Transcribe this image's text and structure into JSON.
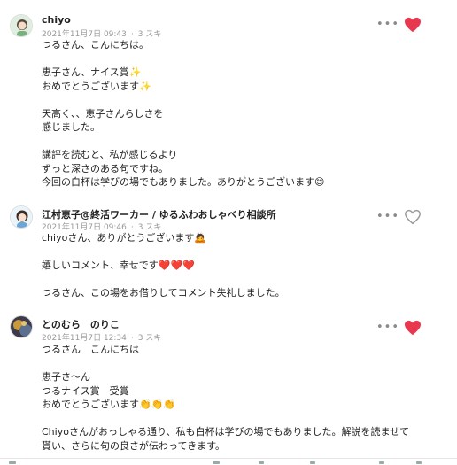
{
  "comments": [
    {
      "name": "chiyo",
      "date": "2021年11月7日 09:43",
      "likes": "3 スキ",
      "liked": true,
      "lines": [
        "つるさん、こんにちは。",
        "",
        "恵子さん、ナイス賞✨",
        "おめでとうございます✨",
        "",
        "天高く、、恵子さんらしさを",
        "感じました。",
        "",
        "講評を読むと、私が感じるより",
        "ずっと深さのある句ですね。",
        "今回の白杯は学びの場でもありました。ありがとうございます😊"
      ]
    },
    {
      "name": "江村恵子@終活ワーカー / ゆるふわおしゃべり相談所",
      "date": "2021年11月7日 09:46",
      "likes": "3 スキ",
      "liked": false,
      "lines": [
        "chiyoさん、ありがとうございます🙇",
        "",
        "嬉しいコメント、幸せです❤️❤️❤️",
        "",
        "つるさん、この場をお借りしてコメント失礼しました。"
      ]
    },
    {
      "name": "とのむら　のりこ",
      "date": "2021年11月7日 12:34",
      "likes": "3 スキ",
      "liked": true,
      "lines": [
        "つるさん　こんにちは",
        "",
        "恵子さ〜ん",
        "つるナイス賞　受賞",
        "おめでとうございます👏👏👏",
        "",
        "Chiyoさんがおっしゃる通り、私も白杯は学びの場でもありました。解説を読ませて貰い、さらに句の良さが伝わってきます。"
      ]
    }
  ],
  "more_label": "•••",
  "colors": {
    "heart_active": "#e8384f",
    "heart_inactive": "#999999"
  }
}
